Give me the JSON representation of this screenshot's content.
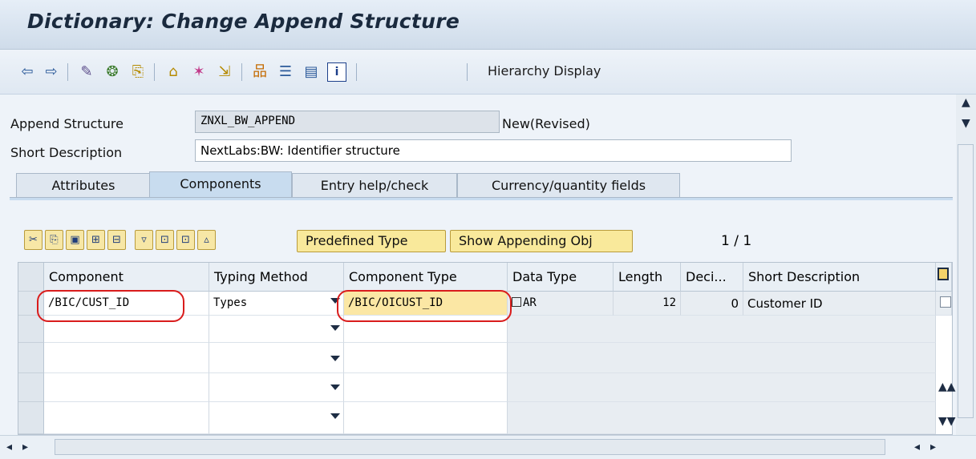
{
  "window": {
    "title": "Dictionary: Change Append Structure"
  },
  "toolbar": {
    "icons": [
      "back-arrow-icon",
      "forward-arrow-icon",
      "display-change-icon",
      "activate-icon",
      "check-icon",
      "where-used-icon",
      "magic-wand-icon",
      "move-icon",
      "hierarchy-icon",
      "list-icon",
      "table-icon",
      "info-icon"
    ],
    "hierarchy_label": "Hierarchy Display"
  },
  "form": {
    "append_structure_label": "Append Structure",
    "append_structure_value": "ZNXL_BW_APPEND",
    "status": "New(Revised)",
    "short_desc_label": "Short Description",
    "short_desc_value": "NextLabs:BW: Identifier structure"
  },
  "tabs": [
    {
      "label": "Attributes",
      "active": false
    },
    {
      "label": "Components",
      "active": true
    },
    {
      "label": "Entry help/check",
      "active": false
    },
    {
      "label": "Currency/quantity fields",
      "active": false
    }
  ],
  "table_toolbar": {
    "predefined_type": "Predefined Type",
    "show_appending": "Show Appending Obj",
    "page_count": "1 / 1"
  },
  "grid": {
    "columns": [
      "Component",
      "Typing Method",
      "Component Type",
      "Data Type",
      "Length",
      "Deci...",
      "Short Description"
    ],
    "rows": [
      {
        "component": "/BIC/CUST_ID",
        "typing_method": "Types",
        "component_type": "/BIC/OICUST_ID",
        "data_type": "AR",
        "length": "12",
        "decimals": "0",
        "short_description": "Customer ID"
      },
      {
        "component": "",
        "typing_method": "",
        "component_type": "",
        "data_type": "",
        "length": "",
        "decimals": "",
        "short_description": ""
      },
      {
        "component": "",
        "typing_method": "",
        "component_type": "",
        "data_type": "",
        "length": "",
        "decimals": "",
        "short_description": ""
      },
      {
        "component": "",
        "typing_method": "",
        "component_type": "",
        "data_type": "",
        "length": "",
        "decimals": "",
        "short_description": ""
      },
      {
        "component": "",
        "typing_method": "",
        "component_type": "",
        "data_type": "",
        "length": "",
        "decimals": "",
        "short_description": ""
      }
    ]
  },
  "colors": {
    "accent_yellow": "#f9e99b",
    "highlight_red": "#d91c1c",
    "tab_active": "#c8dcef"
  }
}
